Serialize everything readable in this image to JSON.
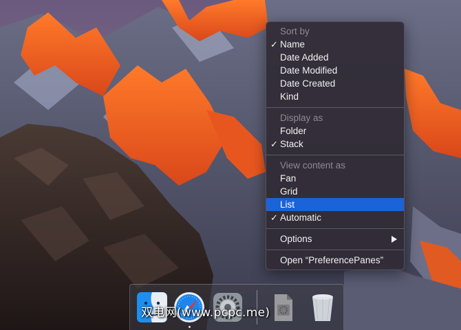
{
  "menu": {
    "sections": [
      {
        "header": "Sort by",
        "items": [
          {
            "label": "Name",
            "checked": true
          },
          {
            "label": "Date Added",
            "checked": false
          },
          {
            "label": "Date Modified",
            "checked": false
          },
          {
            "label": "Date Created",
            "checked": false
          },
          {
            "label": "Kind",
            "checked": false
          }
        ]
      },
      {
        "header": "Display as",
        "items": [
          {
            "label": "Folder",
            "checked": false
          },
          {
            "label": "Stack",
            "checked": true
          }
        ]
      },
      {
        "header": "View content as",
        "items": [
          {
            "label": "Fan",
            "checked": false
          },
          {
            "label": "Grid",
            "checked": false
          },
          {
            "label": "List",
            "checked": false,
            "highlighted": true
          },
          {
            "label": "Automatic",
            "checked": true
          }
        ]
      }
    ],
    "options_label": "Options",
    "open_label": "Open “PreferencePanes”",
    "check_glyph": "✓",
    "highlight_color": "#1a63d8"
  },
  "dock": {
    "apps": [
      {
        "name": "Finder",
        "icon": "finder-icon"
      },
      {
        "name": "Safari",
        "icon": "safari-icon"
      },
      {
        "name": "System Preferences",
        "icon": "system-preferences-icon"
      },
      {
        "name": "PreferencePanes",
        "icon": "document-stack-icon"
      },
      {
        "name": "Trash",
        "icon": "trash-icon"
      }
    ]
  },
  "watermark": "双电网(www.pcpc.me)"
}
